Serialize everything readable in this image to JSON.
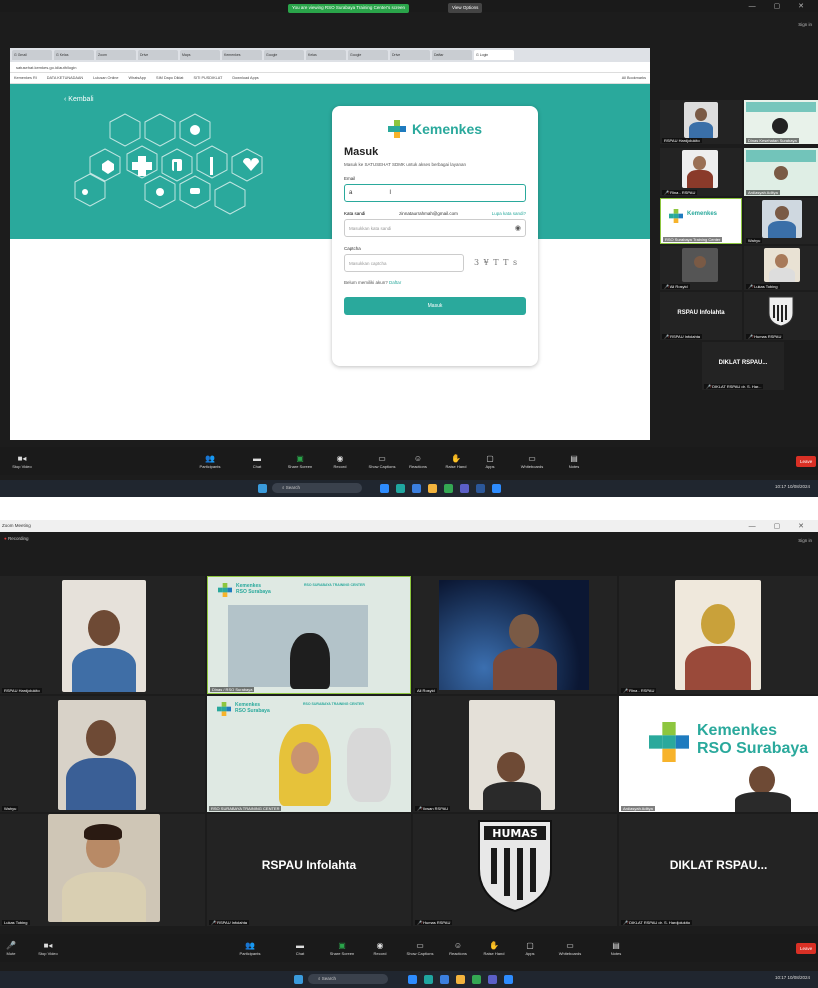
{
  "screen1": {
    "share_banner": "You are viewing RSO Surabaya Training Center's screen",
    "view_options": "View Options",
    "signin": "Sign in",
    "browser": {
      "tabs": [
        "G Gmail",
        "G Kelas",
        "Zoom",
        "Drive",
        "Maps",
        "Kemenkes",
        "Google",
        "Kelas",
        "Google",
        "Drive",
        "Daftar",
        "G Login"
      ],
      "url": "satusehat.kemkes.go.id/auth/login",
      "bookmarks": [
        "Kemenkes RI",
        "DATA KETUNADAAN",
        "Lulusan Online",
        "WhatsApp",
        "SIM Dapo Diklat",
        "SITI PUSDIKLAT",
        "Download Apps",
        "All Bookmarks"
      ]
    },
    "login": {
      "back": "‹ Kembali",
      "brand": "Kemenkes",
      "title": "Masuk",
      "subtitle": "Masuk ke SATUSEHAT SDMK untuk akses berbagai layanan",
      "email_label": "Email",
      "email_value": "a",
      "password_label": "Kata sandi",
      "password_hint": "zinnataurrahmah@gmail.com",
      "forgot": "Lupa kata sandi?",
      "password_placeholder": "Masukkan kata sandi",
      "captcha_label": "Captcha",
      "captcha_placeholder": "Masukkan captcha",
      "captcha_text": "3 ¥ T T s",
      "register_text": "Belum memiliki akun?",
      "register_link": "Daftar",
      "submit": "Masuk"
    },
    "participants": [
      {
        "name": "RSPAU Hardjolukito"
      },
      {
        "name": "Dinas Kesehatan Surabaya"
      },
      {
        "name": "Rina - RSPAU"
      },
      {
        "name": "Ardiasyah Aditya"
      },
      {
        "name": "RSO Surabaya Training Center"
      },
      {
        "name": "Wahyu"
      },
      {
        "name": "Ali Rosyid"
      },
      {
        "name": "Lukas Tobing"
      },
      {
        "name": "RSPAU Infolahta",
        "big": "RSPAU Infolahta"
      },
      {
        "name": "Humas RSPAU"
      },
      {
        "name": "DIKLAT RSPAU dr. S. Har...",
        "big": "DIKLAT RSPAU..."
      }
    ],
    "toolbar": [
      "Stop Video",
      "Participants",
      "Chat",
      "Share Screen",
      "Record",
      "Show Captions",
      "Reactions",
      "Raise Hand",
      "Apps",
      "Whiteboards",
      "Notes"
    ],
    "leave": "Leave",
    "taskbar": {
      "search": "Search",
      "clock": "10:17",
      "date": "10/08/2024"
    }
  },
  "screen2": {
    "title": "Zoom Meeting",
    "recording": "Recording",
    "signin": "Sign in",
    "tiles": [
      {
        "name": "RSPAU Hardjolukito"
      },
      {
        "name": "Dinas / RSO Surabaya",
        "banner_title": "RSO SURABAYA TRAINING CENTER"
      },
      {
        "name": "Ali Rosyid"
      },
      {
        "name": "Rina - RSPAU"
      },
      {
        "name": "Wahyu"
      },
      {
        "name": "RSO SURABAYA TRAINING CENTER"
      },
      {
        "name": "Ikwan RSPAU"
      },
      {
        "name": "Ardiasyah Aditya"
      },
      {
        "name": "Lukas Tobing"
      },
      {
        "name": "RSPAU Infolahta",
        "big": "RSPAU Infolahta"
      },
      {
        "name": "Humas RSPAU",
        "logo": "HUMAS"
      },
      {
        "name": "DIKLAT RSPAU dr. S. Hardjolukito",
        "big": "DIKLAT RSPAU..."
      }
    ],
    "brand_line1": "Kemenkes",
    "brand_line2": "RSO Surabaya",
    "toolbar": [
      "Mute",
      "Stop Video",
      "Participants",
      "Chat",
      "Share Screen",
      "Record",
      "Show Captions",
      "Reactions",
      "Raise Hand",
      "Apps",
      "Whiteboards",
      "Notes"
    ],
    "leave": "Leave",
    "taskbar": {
      "search": "Search",
      "clock": "10:17",
      "date": "10/08/2024"
    }
  },
  "colors": {
    "teal": "#2aa99c",
    "zoom_dark": "#1c1c1c",
    "leave_red": "#d93025",
    "share_green": "#2aa44a"
  }
}
